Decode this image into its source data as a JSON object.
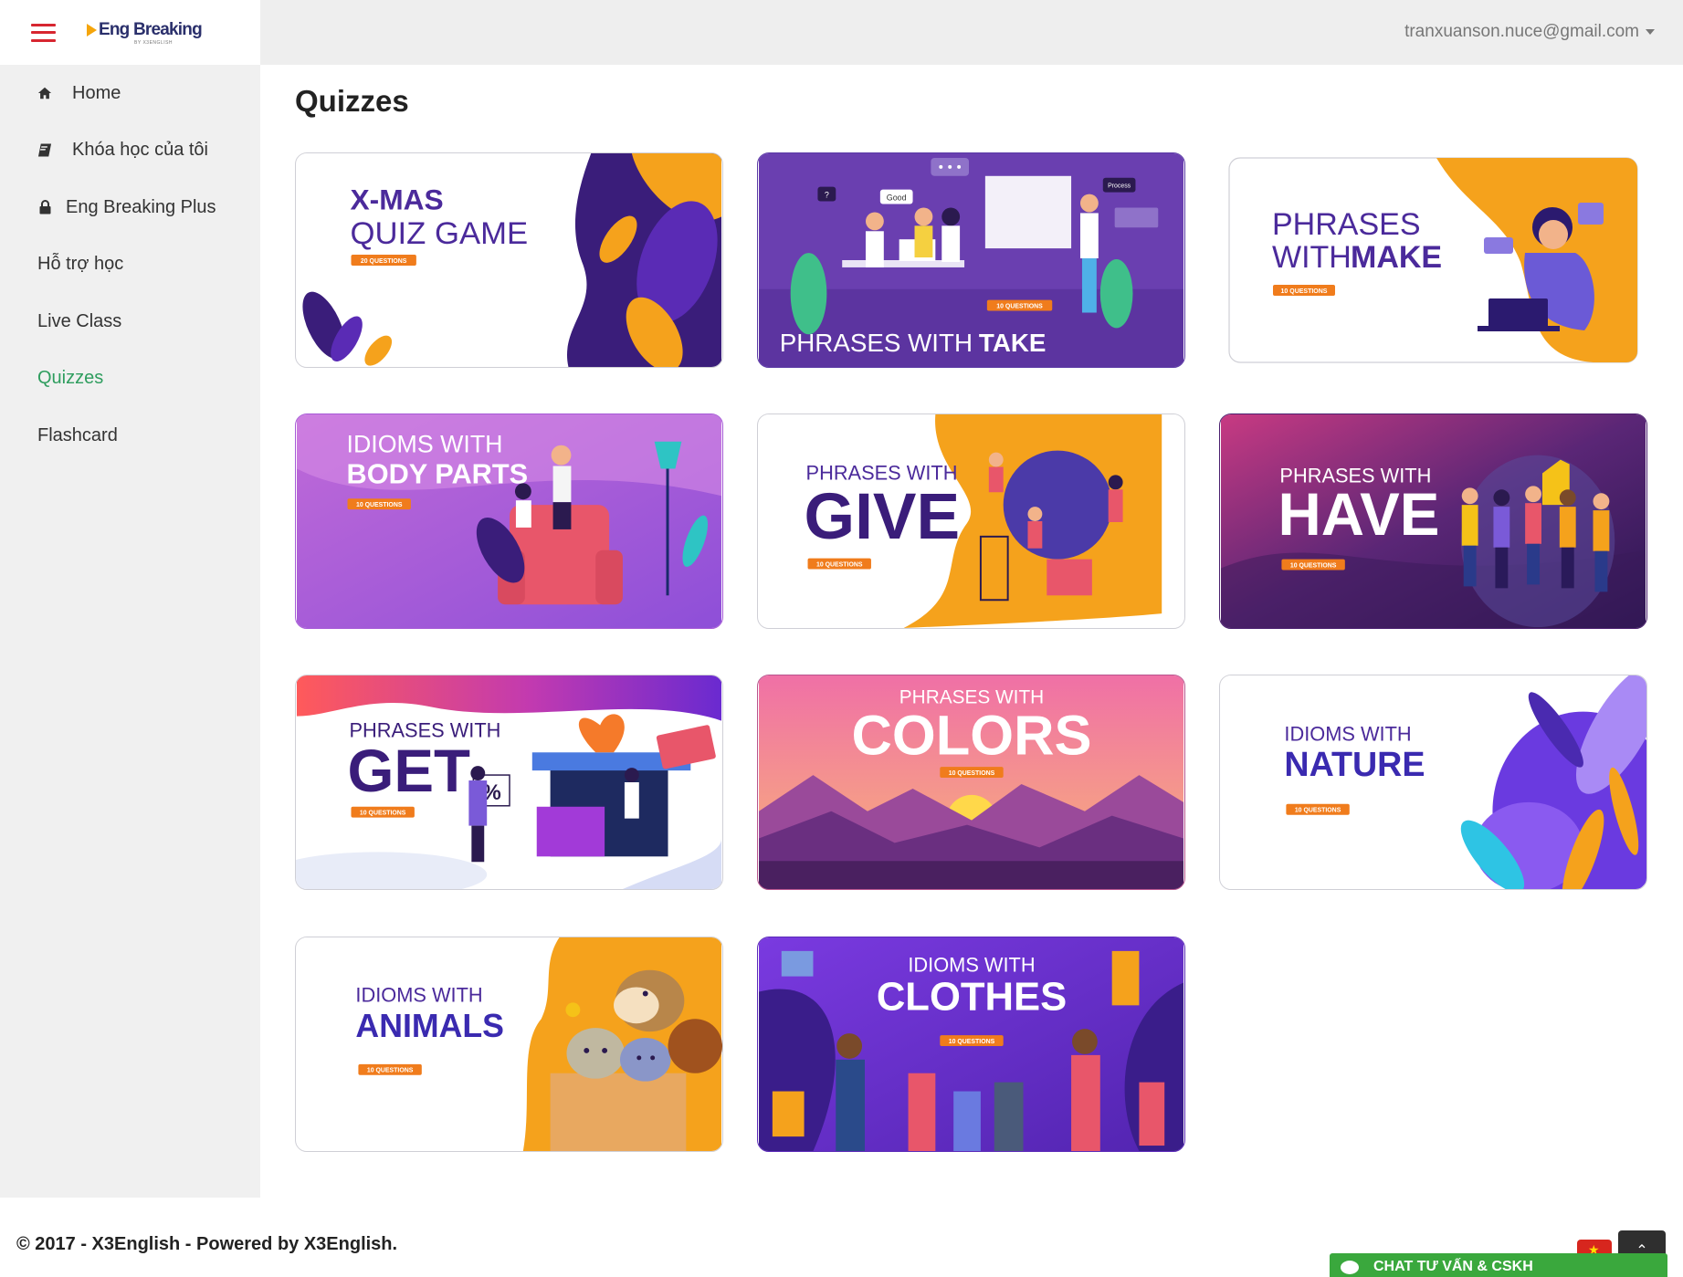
{
  "sidebar": {
    "brand": {
      "logo_text": "Eng Breaking",
      "logo_sub": "BY X3ENGLISH"
    },
    "items": [
      {
        "label": "Home",
        "icon": "home-icon"
      },
      {
        "label": "Khóa học của tôi",
        "icon": "book-icon"
      },
      {
        "label": "Eng Breaking Plus",
        "icon": "lock-icon"
      },
      {
        "label": "Hỗ trợ học",
        "icon": ""
      },
      {
        "label": "Live Class",
        "icon": ""
      },
      {
        "label": "Quizzes",
        "icon": "",
        "active": true
      },
      {
        "label": "Flashcard",
        "icon": ""
      }
    ]
  },
  "header": {
    "user_email": "tranxuanson.nuce@gmail.com"
  },
  "main": {
    "title": "Quizzes",
    "quizzes": [
      {
        "line1": "X-MAS",
        "line2": "QUIZ GAME",
        "badge": "20 QUESTIONS"
      },
      {
        "line1": "PHRASES WITH",
        "line2": "TAKE",
        "badge": "10 QUESTIONS",
        "bubble1": "?",
        "bubble2": "Good",
        "bubble3": "Process"
      },
      {
        "line1": "PHRASES",
        "line2": "WITH",
        "line3": "MAKE",
        "badge": "10 QUESTIONS"
      },
      {
        "line1": "IDIOMS WITH",
        "line2": "BODY PARTS",
        "badge": "10 QUESTIONS"
      },
      {
        "line1": "PHRASES WITH",
        "line2": "GIVE",
        "badge": "10 QUESTIONS"
      },
      {
        "line1": "PHRASES WITH",
        "line2": "HAVE",
        "badge": "10 QUESTIONS"
      },
      {
        "line1": "PHRASES WITH",
        "line2": "GET",
        "badge": "10 QUESTIONS",
        "sign": "%"
      },
      {
        "line1": "PHRASES WITH",
        "line2": "COLORS",
        "badge": "10 QUESTIONS"
      },
      {
        "line1": "IDIOMS WITH",
        "line2": "NATURE",
        "badge": "10 QUESTIONS"
      },
      {
        "line1": "IDIOMS WITH",
        "line2": "ANIMALS",
        "badge": "10 QUESTIONS"
      },
      {
        "line1": "IDIOMS WITH",
        "line2": "CLOTHES",
        "badge": "10 QUESTIONS"
      }
    ]
  },
  "footer": {
    "copyright": "© 2017 - X3English - Powered by X3English."
  },
  "widgets": {
    "chat_label": "CHAT TƯ VẤN & CSKH",
    "back_to_top": "⌃"
  },
  "colors": {
    "active_nav": "#2e9d5e",
    "hamburger": "#d72630",
    "badge": "#f07c1c",
    "purple": "#4b2a9b",
    "chat": "#3aa83d"
  }
}
